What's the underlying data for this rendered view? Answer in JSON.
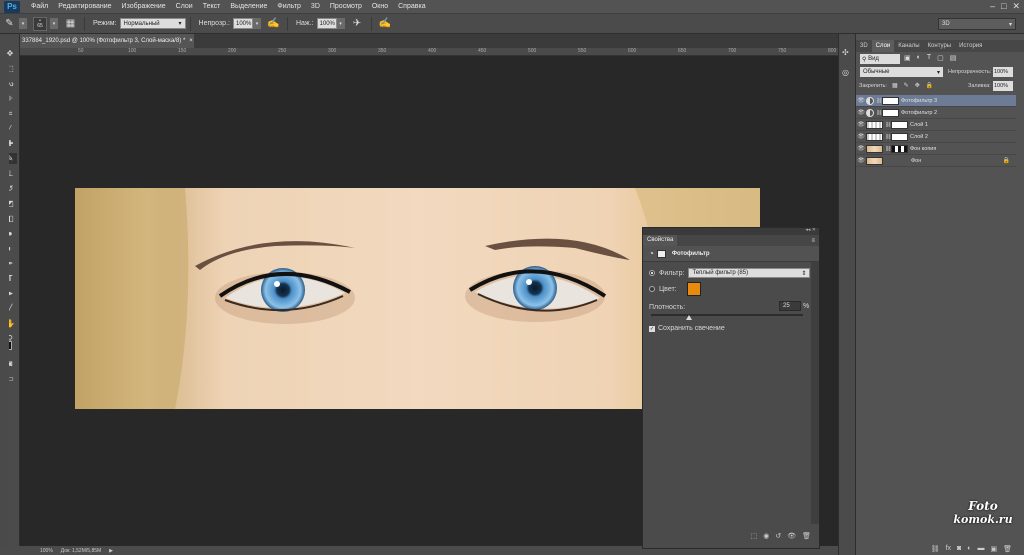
{
  "app": {
    "logo": "Ps"
  },
  "menu": [
    "Файл",
    "Редактирование",
    "Изображение",
    "Слои",
    "Текст",
    "Выделение",
    "Фильтр",
    "3D",
    "Просмотр",
    "Окно",
    "Справка"
  ],
  "options": {
    "brush_size": "65",
    "mode_label": "Режим:",
    "mode_value": "Нормальный",
    "opacity_label": "Непрозр.:",
    "opacity_value": "100%",
    "flow_label": "Наж.:",
    "flow_value": "100%",
    "workspace": "3D"
  },
  "document_tab": {
    "title": "337884_1920.psd @ 100% (Фотофильтр 3, Слой-маска/8) *",
    "close": "×"
  },
  "status": {
    "zoom": "100%",
    "doc_info": "Док: 1,52М/5,85М"
  },
  "layers_panel": {
    "tabs": [
      "3D",
      "Слои",
      "Каналы",
      "Контуры",
      "История"
    ],
    "active_tab": "Слои",
    "kind_label": "Вид",
    "blend_mode": "Обычные",
    "opacity_label": "Непрозрачность:",
    "opacity_value": "100%",
    "lock_label": "Закрепить:",
    "fill_label": "Заливка:",
    "fill_value": "100%",
    "layers": [
      {
        "name": "Фотофильтр 3",
        "selected": true,
        "kind": "adjustment"
      },
      {
        "name": "Фотофильтр 2",
        "selected": false,
        "kind": "adjustment"
      },
      {
        "name": "Слой 1",
        "selected": false,
        "kind": "masked"
      },
      {
        "name": "Слой 2",
        "selected": false,
        "kind": "masked"
      },
      {
        "name": "Фон копия",
        "selected": false,
        "kind": "photo-masked"
      },
      {
        "name": "Фон",
        "selected": false,
        "kind": "photo-locked"
      }
    ]
  },
  "properties": {
    "tab": "Свойства",
    "title": "Фотофильтр",
    "filter_label": "Фильтр:",
    "filter_value": "Теплый фильтр (85)",
    "color_label": "Цвет:",
    "color_swatch": "#e98a0d",
    "density_label": "Плотность:",
    "density_value": "25",
    "density_unit": "%",
    "density_fraction": 0.25,
    "preserve_label": "Сохранить свечение",
    "preserve_checked": true
  },
  "watermark": {
    "line1": "Foto",
    "line2": "komok.ru"
  },
  "ruler_top": [
    "50",
    "100",
    "150",
    "200",
    "250",
    "300",
    "350",
    "400",
    "450",
    "500",
    "550",
    "600",
    "650",
    "700",
    "750",
    "800"
  ],
  "colors": {
    "foreground": "#111111",
    "background": "#ffffff",
    "selection": "#6d7b96"
  }
}
